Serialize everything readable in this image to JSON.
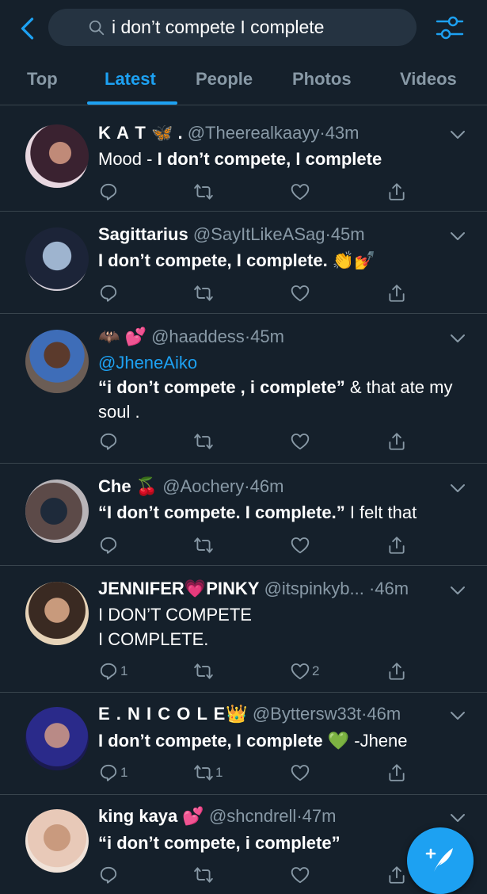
{
  "search": {
    "query": "i don’t compete I complete"
  },
  "tabs": [
    {
      "label": "Top"
    },
    {
      "label": "Latest"
    },
    {
      "label": "People"
    },
    {
      "label": "Photos"
    },
    {
      "label": "Videos"
    }
  ],
  "tweets": [
    {
      "name": "K A T",
      "name_suffix": ".",
      "handle": "@Theerealkaayy",
      "dot": "·",
      "time": "43m",
      "text_pre": "Mood - ",
      "text_bold": "I don’t compete, I complete",
      "replies": "",
      "retweets": "",
      "likes": ""
    },
    {
      "name": "Sagittarius",
      "handle": "@SayItLikeASag",
      "dot": "·",
      "time": "45m",
      "text": "I don’t compete, I complete.",
      "replies": "",
      "retweets": "",
      "likes": ""
    },
    {
      "name": "",
      "handle": "@haaddess",
      "dot": "·",
      "time": "45m",
      "mention": "@JheneAiko",
      "text_bold": "“i don’t compete , i complete”",
      "text_rest": " & that ate my soul .",
      "replies": "",
      "retweets": "",
      "likes": ""
    },
    {
      "name": "Che",
      "handle": "@Aochery",
      "dot": "·",
      "time": "46m",
      "text_bold": "“I don’t compete. I complete.”",
      "text_rest": " I felt that",
      "replies": "",
      "retweets": "",
      "likes": ""
    },
    {
      "name": "JENNIFER",
      "name2": "PINKY",
      "handle": "@itspinkyb...",
      "dot": "·",
      "time": "46m",
      "line1": "I DON’T COMPETE",
      "line2": "I COMPLETE.",
      "replies": "1",
      "retweets": "",
      "likes": "2"
    },
    {
      "name": "E . N I C O L E",
      "handle": "@Byttersw33t",
      "dot": "·",
      "time": "46m",
      "text_bold": "I don’t compete, I complete",
      "text_rest": " -Jhene",
      "replies": "1",
      "retweets": "1",
      "likes": ""
    },
    {
      "name": "king kaya",
      "handle": "@shcndrell",
      "dot": "·",
      "time": "47m",
      "text_bold": "“i don’t compete, i complete”",
      "replies": "",
      "retweets": "",
      "likes": ""
    }
  ],
  "colors": {
    "background": "#15202b",
    "accent": "#1da1f2",
    "muted": "#8899a6",
    "divider": "#38444d",
    "search_bg": "#253341"
  },
  "icons": [
    "back-arrow-icon",
    "search-icon",
    "filter-icon",
    "reply-icon",
    "retweet-icon",
    "like-icon",
    "share-icon",
    "chevron-down-icon",
    "compose-icon"
  ]
}
